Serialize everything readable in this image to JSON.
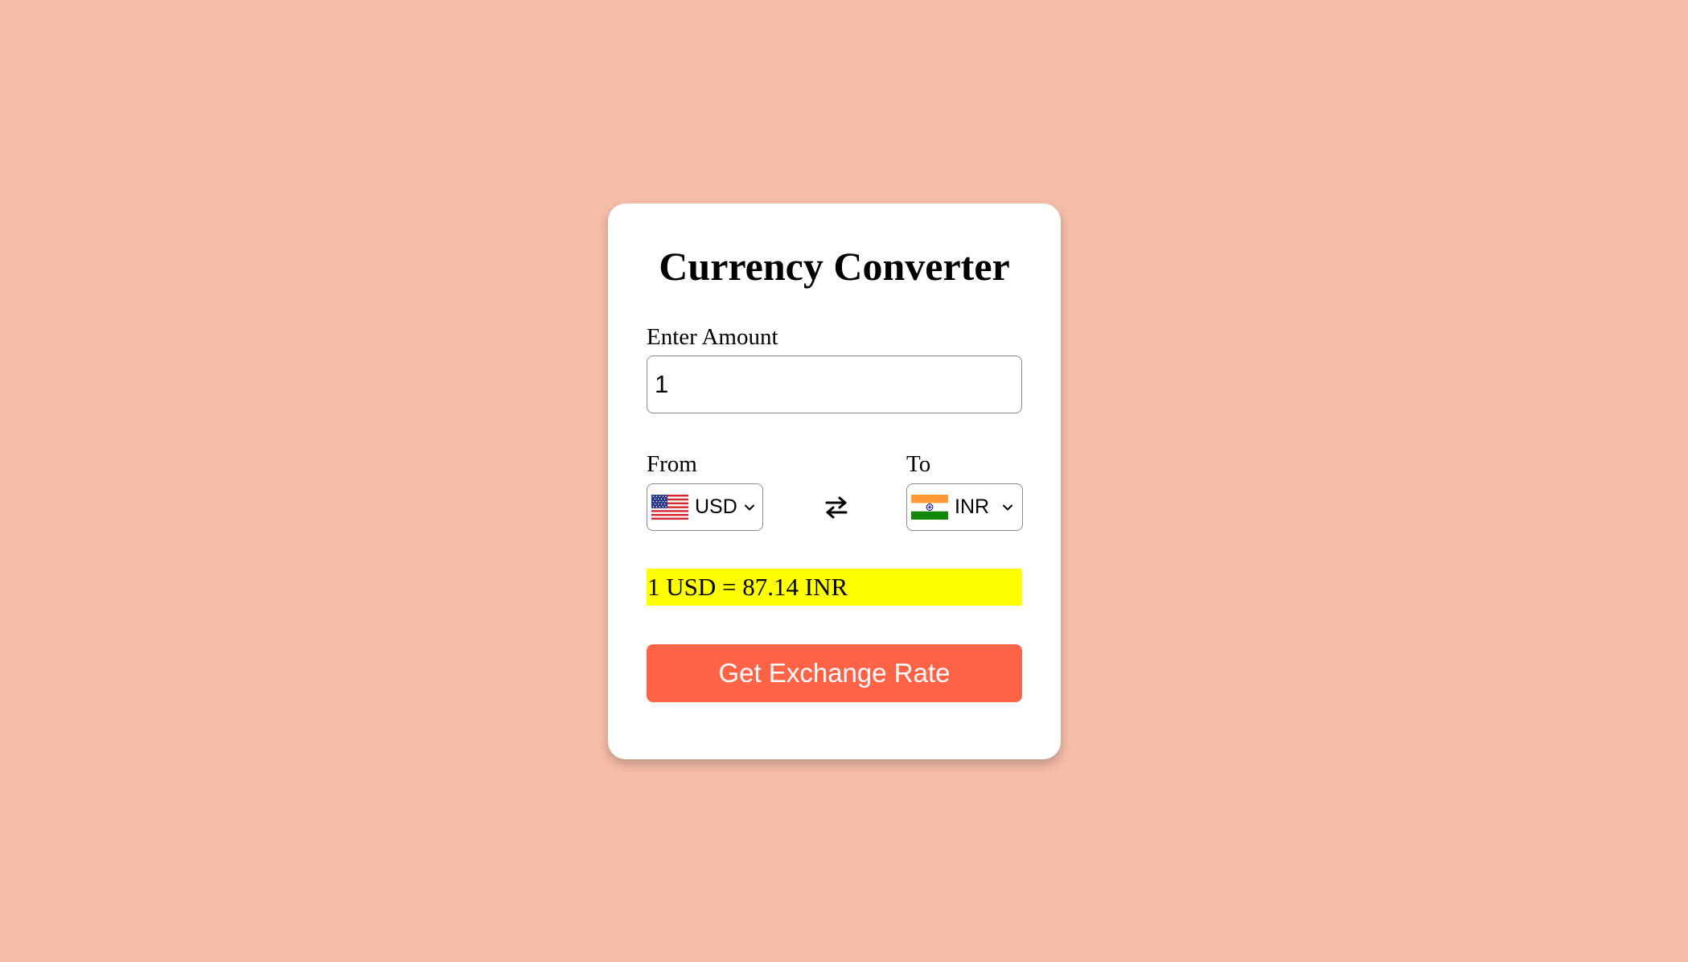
{
  "app": {
    "title": "Currency Converter"
  },
  "amount": {
    "label": "Enter Amount",
    "value": "1"
  },
  "from": {
    "label": "From",
    "currency": "USD",
    "flag_icon": "us-flag-icon"
  },
  "to": {
    "label": "To",
    "currency": "INR",
    "flag_icon": "india-flag-icon"
  },
  "swap": {
    "icon": "swap-arrows-icon"
  },
  "result": {
    "text": "1 USD = 87.14 INR"
  },
  "button": {
    "label": "Get Exchange Rate"
  },
  "colors": {
    "background": "#f4bda8",
    "card": "#ffffff",
    "result_highlight": "#ffff00",
    "button": "#ff6347"
  }
}
